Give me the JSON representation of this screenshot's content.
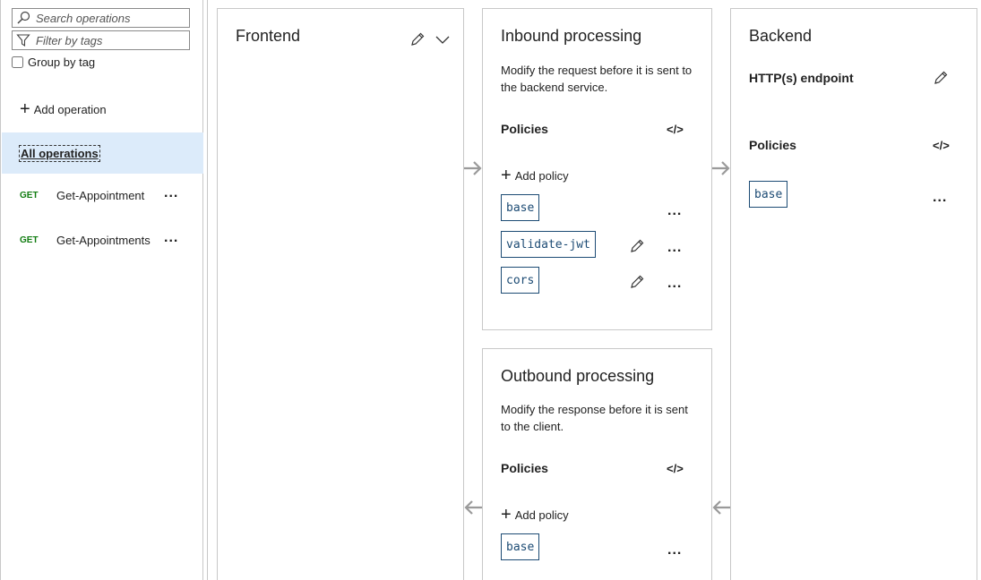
{
  "left_pane": {
    "search_placeholder": "Search operations",
    "filter_placeholder": "Filter by tags",
    "group_by_tag_label": "Group by tag",
    "group_by_tag_checked": false,
    "add_operation_label": "Add operation",
    "all_operations_label": "All operations",
    "operations": [
      {
        "verb": "GET",
        "name": "Get-Appointment",
        "more": "..."
      },
      {
        "verb": "GET",
        "name": "Get-Appointments",
        "more": "..."
      }
    ],
    "verb_color": "#107c10",
    "selected_bg": "#dcebfa"
  },
  "frontend": {
    "title": "Frontend",
    "edit_icon": "pencil-icon",
    "expand_icon": "chevron-down-icon"
  },
  "inbound": {
    "title": "Inbound processing",
    "description": "Modify the request before it is sent to the backend service.",
    "policies_label": "Policies",
    "code_icon_text": "</>",
    "add_policy_label": "Add policy",
    "policies": [
      {
        "name": "base",
        "editable": false,
        "more": "..."
      },
      {
        "name": "validate-jwt",
        "editable": true,
        "more": "..."
      },
      {
        "name": "cors",
        "editable": true,
        "more": "..."
      }
    ]
  },
  "outbound": {
    "title": "Outbound processing",
    "description": "Modify the response before it is sent to the client.",
    "policies_label": "Policies",
    "code_icon_text": "</>",
    "add_policy_label": "Add policy",
    "policies": [
      {
        "name": "base",
        "more": "..."
      }
    ]
  },
  "backend": {
    "title": "Backend",
    "endpoint_label": "HTTP(s) endpoint",
    "policies_label": "Policies",
    "code_icon_text": "</>",
    "policies": [
      {
        "name": "base",
        "more": "..."
      }
    ]
  },
  "colors": {
    "chip_border": "#1c4b74",
    "arrow": "#9a9a9a",
    "card_border": "#c8c8c8"
  }
}
